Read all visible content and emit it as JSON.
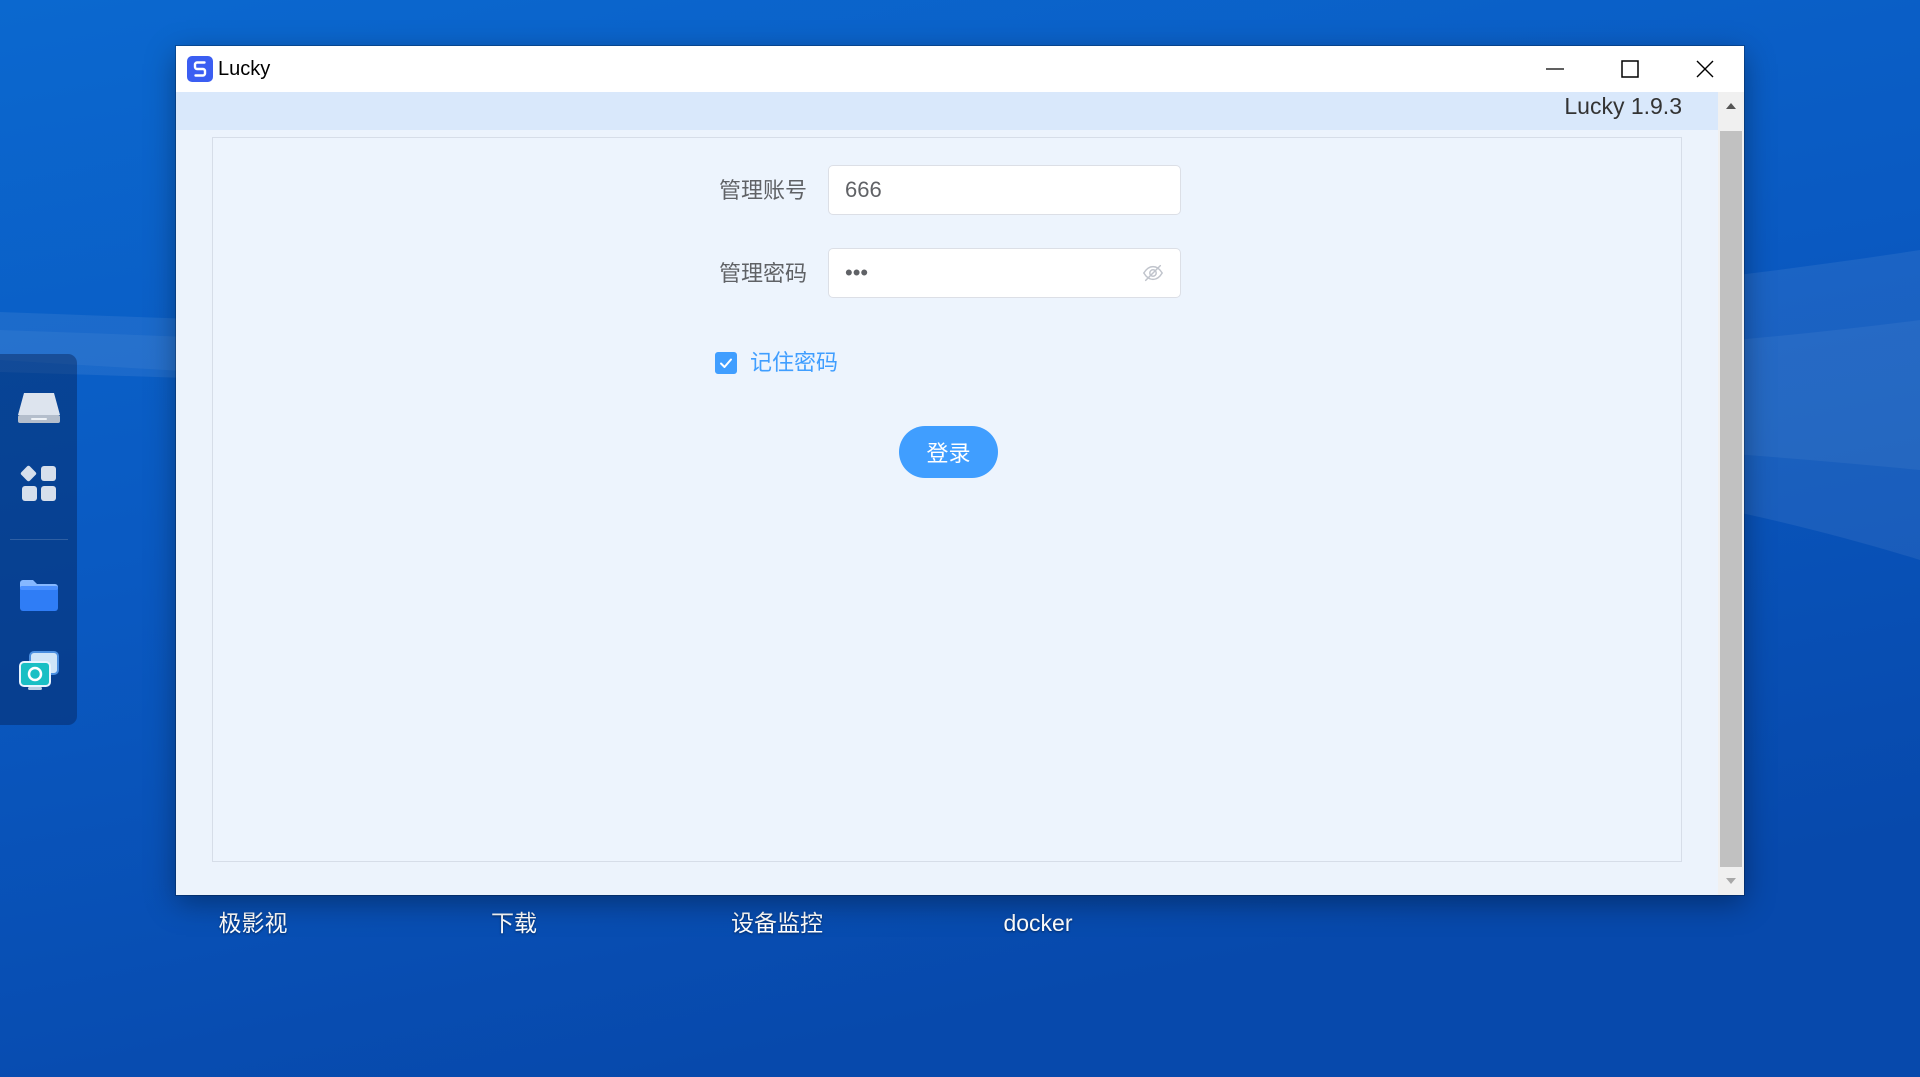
{
  "window": {
    "title": "Lucky",
    "app_icon": "lucky-app-icon",
    "controls": {
      "minimize_icon": "minimize-icon",
      "maximize_icon": "maximize-icon",
      "close_icon": "close-icon"
    }
  },
  "header": {
    "version": "Lucky 1.9.3"
  },
  "login_form": {
    "username": {
      "label": "管理账号",
      "value": "666"
    },
    "password": {
      "label": "管理密码",
      "value": "•••",
      "toggle_icon": "eye-off-icon"
    },
    "remember": {
      "label": "记住密码",
      "checked": true,
      "check_icon": "check-icon"
    },
    "submit_label": "登录"
  },
  "scrollbar": {
    "up_icon": "scroll-up-arrow-icon",
    "down_icon": "scroll-down-arrow-icon"
  },
  "desktop": {
    "icon_labels": [
      "极影视",
      "下载",
      "设备监控",
      "docker"
    ]
  },
  "dock": {
    "items": [
      {
        "icon": "drive-icon"
      },
      {
        "icon": "apps-grid-icon"
      },
      {
        "icon": "folder-icon"
      },
      {
        "icon": "chat-monitor-icon"
      }
    ]
  },
  "colors": {
    "accent": "#409eff",
    "header_band": "#d9e8fb",
    "page_background": "#ecf3fc",
    "label_text": "#606266",
    "desktop_blue": "#0a5ac2"
  }
}
